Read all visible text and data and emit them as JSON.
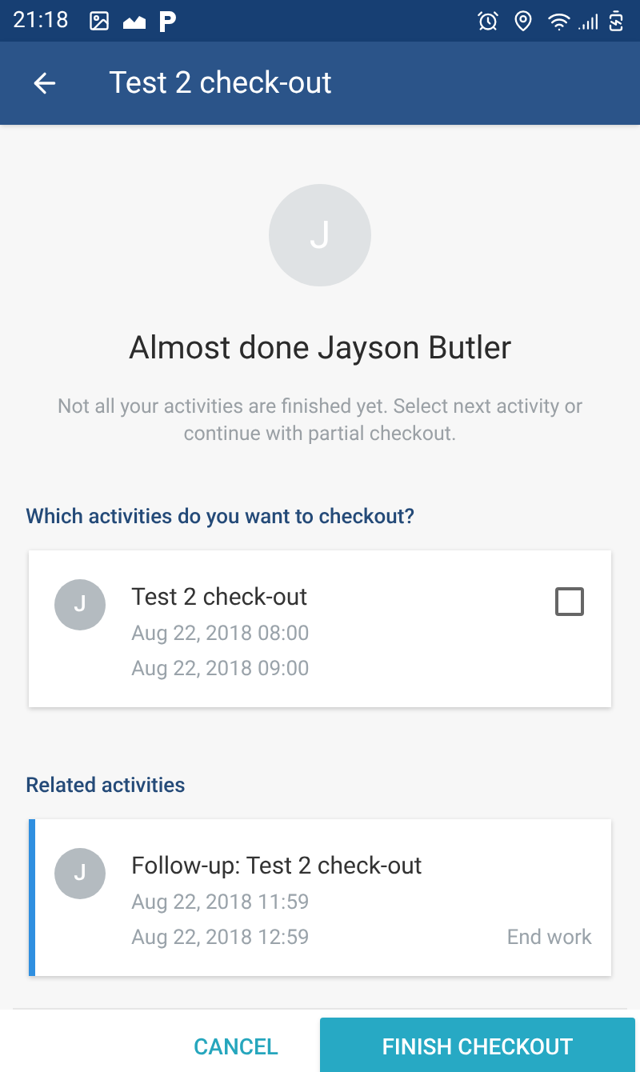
{
  "status_bar": {
    "time": "21:18"
  },
  "app_bar": {
    "title": "Test 2 check-out"
  },
  "header": {
    "avatar_initial": "J",
    "title": "Almost done Jayson Butler",
    "subtitle": "Not all your activities are finished yet. Select next activity or continue with partial checkout."
  },
  "checkout_section": {
    "label": "Which activities do you want to checkout?",
    "items": [
      {
        "avatar_initial": "J",
        "title": "Test 2 check-out",
        "start": "Aug 22, 2018 08:00",
        "end": "Aug 22, 2018 09:00",
        "checked": false
      }
    ]
  },
  "related_section": {
    "label": "Related activities",
    "items": [
      {
        "avatar_initial": "J",
        "title": "Follow-up: Test 2 check-out",
        "start": "Aug 22, 2018 11:59",
        "end": "Aug 22, 2018 12:59",
        "status": "End work",
        "color": "#2f8fe0"
      }
    ]
  },
  "buttons": [
    {
      "label": "CANCEL",
      "kind": "text"
    },
    {
      "label": "FINISH CHECKOUT",
      "kind": "filled"
    }
  ]
}
